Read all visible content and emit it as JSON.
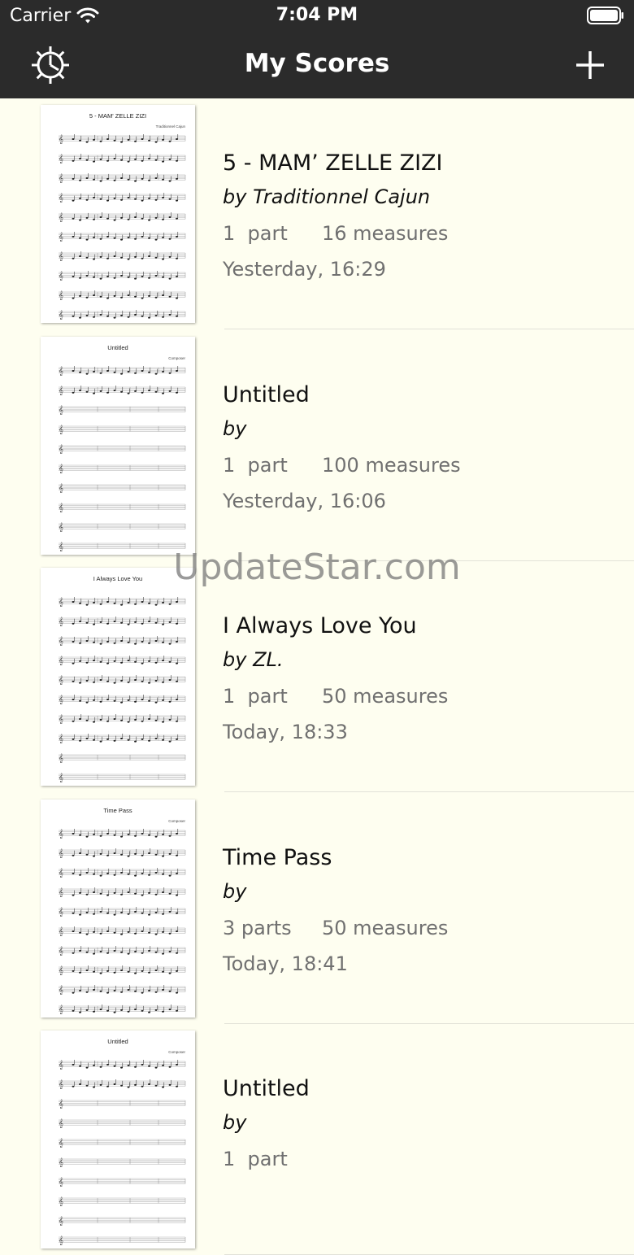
{
  "status_bar": {
    "carrier": "Carrier",
    "time": "7:04 PM",
    "wifi_icon": "wifi-icon",
    "battery_icon": "battery-icon"
  },
  "nav": {
    "title": "My Scores",
    "settings_icon": "gear-icon",
    "add_icon": "plus-icon"
  },
  "scores": [
    {
      "title": "5 - MAM’ ZELLE ZIZI",
      "composer": "by Traditionnel Cajun",
      "parts": "1  part",
      "measures": "16 measures",
      "date": "Yesterday, 16:29",
      "thumb_title": "5 - MAM' ZELLE ZIZI",
      "thumb_composer": "Traditionnel Cajun"
    },
    {
      "title": "Untitled",
      "composer": "by",
      "parts": "1  part",
      "measures": "100 measures",
      "date": "Yesterday, 16:06",
      "thumb_title": "Untitled",
      "thumb_composer": "Composer"
    },
    {
      "title": "I Always Love You",
      "composer": "by ZL.",
      "parts": "1  part",
      "measures": "50 measures",
      "date": "Today, 18:33",
      "thumb_title": "I Always Love You",
      "thumb_composer": ""
    },
    {
      "title": "Time Pass",
      "composer": "by",
      "parts": "3 parts",
      "measures": "50 measures",
      "date": "Today, 18:41",
      "thumb_title": "Time Pass",
      "thumb_composer": "Composer"
    },
    {
      "title": "Untitled",
      "composer": "by",
      "parts": "1  part",
      "measures": "",
      "date": "",
      "thumb_title": "Untitled",
      "thumb_composer": "Composer"
    }
  ],
  "watermark": "UpdateStar.com"
}
